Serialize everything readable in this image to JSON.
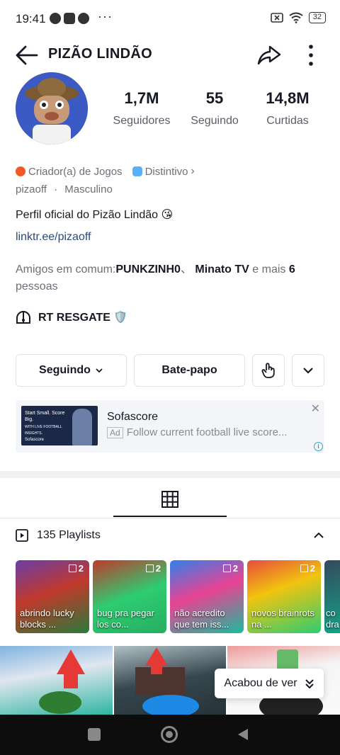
{
  "status_bar": {
    "time": "19:41",
    "dots": "···",
    "battery": "32"
  },
  "header": {
    "title": "PIZÃO LINDÃO"
  },
  "stats": [
    {
      "value": "1,7M",
      "label": "Seguidores"
    },
    {
      "value": "55",
      "label": "Seguindo"
    },
    {
      "value": "14,8M",
      "label": "Curtidas"
    }
  ],
  "profile": {
    "creator_label": "Criador(a) de Jogos",
    "distinctive_label": "Distintivo",
    "username": "pizaoff",
    "gender": "Masculino",
    "separator": "·",
    "bio": "Perfil oficial do Pizão Lindão 😘",
    "link": "linktr.ee/pizaoff",
    "friends_prefix": "Amigos em comum:",
    "friend_1": "PUNKZINH0",
    "friend_sep": "、",
    "friend_2": "Minato TV",
    "friends_mid": " e mais ",
    "friends_count": "6",
    "friends_suffix": "pessoas",
    "group_name": "RT RESGATE 🛡️"
  },
  "actions": {
    "following": "Seguindo",
    "chat": "Bate-papo"
  },
  "ad": {
    "title": "Sofascore",
    "label": "Ad",
    "description": "Follow current football live score...",
    "thumb_text": "Start Small. Score Big.",
    "thumb_sub": "WITH LIVE FOOTBALL INSIGHTS.",
    "thumb_logo": "Sofascore"
  },
  "playlists": {
    "header": "135 Playlists",
    "items": [
      {
        "count": "2",
        "caption": "abrindo lucky blocks ..."
      },
      {
        "count": "2",
        "caption": "bug pra pegar los co..."
      },
      {
        "count": "2",
        "caption": "não acredito que tem iss..."
      },
      {
        "count": "2",
        "caption": "novos brainrots na ..."
      },
      {
        "count": "",
        "caption": "co dra"
      }
    ]
  },
  "seen_popup": "Acabou de ver",
  "colors": {
    "accent_red": "#fe2c55",
    "creator_badge": "#f15a24",
    "link": "#2c4a7a"
  }
}
